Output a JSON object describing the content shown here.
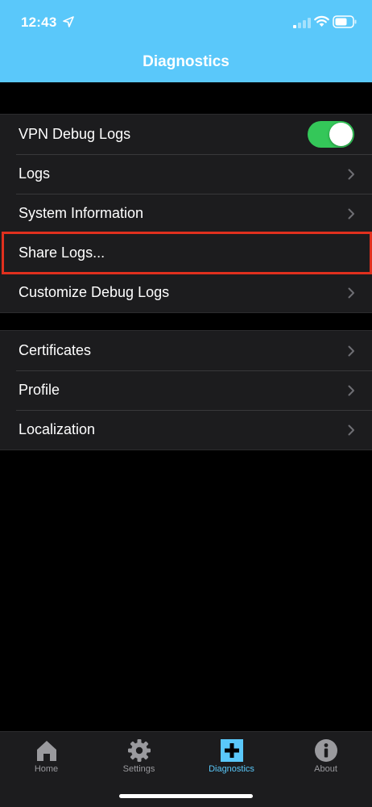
{
  "status_bar": {
    "time": "12:43",
    "icons": [
      "location-arrow-icon",
      "signal-icon",
      "wifi-icon",
      "battery-icon"
    ]
  },
  "nav": {
    "title": "Diagnostics"
  },
  "colors": {
    "header_bg": "#5AC8FA",
    "toggle_on": "#34C759",
    "highlight": "#E0301E",
    "active_tab": "#5AC8FA"
  },
  "group1": {
    "items": [
      {
        "label": "VPN Debug Logs",
        "control": "toggle",
        "toggle_on": true
      },
      {
        "label": "Logs",
        "control": "chevron"
      },
      {
        "label": "System Information",
        "control": "chevron"
      },
      {
        "label": "Share Logs...",
        "control": "none",
        "highlighted": true
      },
      {
        "label": "Customize Debug Logs",
        "control": "chevron"
      }
    ]
  },
  "group2": {
    "items": [
      {
        "label": "Certificates",
        "control": "chevron"
      },
      {
        "label": "Profile",
        "control": "chevron"
      },
      {
        "label": "Localization",
        "control": "chevron"
      }
    ]
  },
  "tabbar": {
    "tabs": [
      {
        "label": "Home",
        "icon": "home-icon",
        "active": false
      },
      {
        "label": "Settings",
        "icon": "gear-icon",
        "active": false
      },
      {
        "label": "Diagnostics",
        "icon": "plus-icon",
        "active": true
      },
      {
        "label": "About",
        "icon": "info-icon",
        "active": false
      }
    ]
  }
}
